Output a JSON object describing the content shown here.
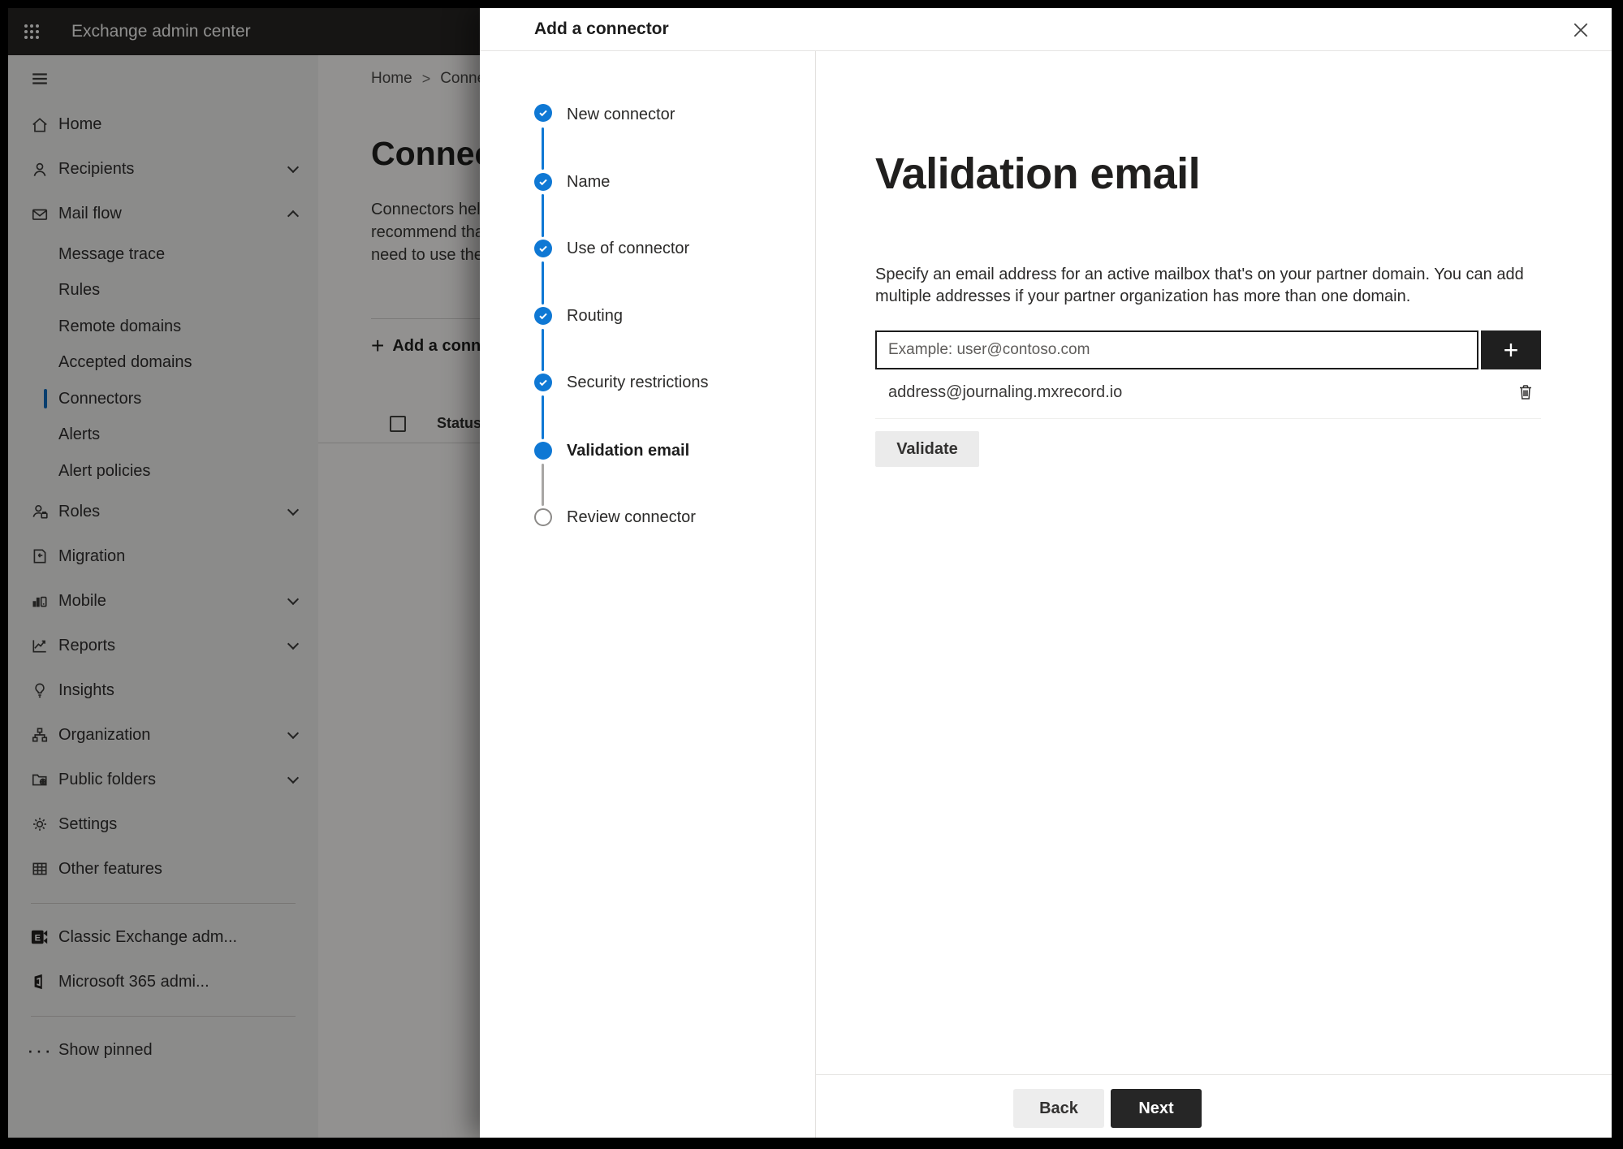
{
  "colors": {
    "accent": "#0f78d4",
    "appbar_bg": "#262524",
    "dark_button": "#262626"
  },
  "icons": {
    "plus": "+",
    "breadcrumb_separator": ">",
    "show_pinned_dots": "···",
    "classic_exchange_letter": "E"
  },
  "app": {
    "title": "Exchange admin center"
  },
  "sidebar": {
    "items": [
      {
        "label": "Home"
      },
      {
        "label": "Recipients"
      },
      {
        "label": "Mail flow"
      },
      {
        "label": "Message trace"
      },
      {
        "label": "Rules"
      },
      {
        "label": "Remote domains"
      },
      {
        "label": "Accepted domains"
      },
      {
        "label": "Connectors"
      },
      {
        "label": "Alerts"
      },
      {
        "label": "Alert policies"
      },
      {
        "label": "Roles"
      },
      {
        "label": "Migration"
      },
      {
        "label": "Mobile"
      },
      {
        "label": "Reports"
      },
      {
        "label": "Insights"
      },
      {
        "label": "Organization"
      },
      {
        "label": "Public folders"
      },
      {
        "label": "Settings"
      },
      {
        "label": "Other features"
      },
      {
        "label": "Classic Exchange adm..."
      },
      {
        "label": "Microsoft 365 admi..."
      },
      {
        "label": "Show pinned"
      }
    ]
  },
  "page": {
    "breadcrumb_home": "Home",
    "breadcrumb_current": "Conne",
    "title": "Connec",
    "description_lines": [
      "Connectors help",
      "recommend that",
      "need to use ther"
    ],
    "add_button": "Add a conn",
    "status_column": "Status"
  },
  "wizard": {
    "title": "Add a connector",
    "steps": [
      {
        "label": "New connector",
        "state": "done"
      },
      {
        "label": "Name",
        "state": "done"
      },
      {
        "label": "Use of connector",
        "state": "done"
      },
      {
        "label": "Routing",
        "state": "done"
      },
      {
        "label": "Security restrictions",
        "state": "done"
      },
      {
        "label": "Validation email",
        "state": "current"
      },
      {
        "label": "Review connector",
        "state": "upcoming"
      }
    ]
  },
  "content": {
    "heading": "Validation email",
    "description": "Specify an email address for an active mailbox that's on your partner domain. You can add multiple addresses if your partner organization has more than one domain.",
    "email_placeholder": "Example: user@contoso.com",
    "addresses": [
      {
        "email": "address@journaling.mxrecord.io"
      }
    ],
    "validate_label": "Validate"
  },
  "footer": {
    "back": "Back",
    "next": "Next"
  }
}
